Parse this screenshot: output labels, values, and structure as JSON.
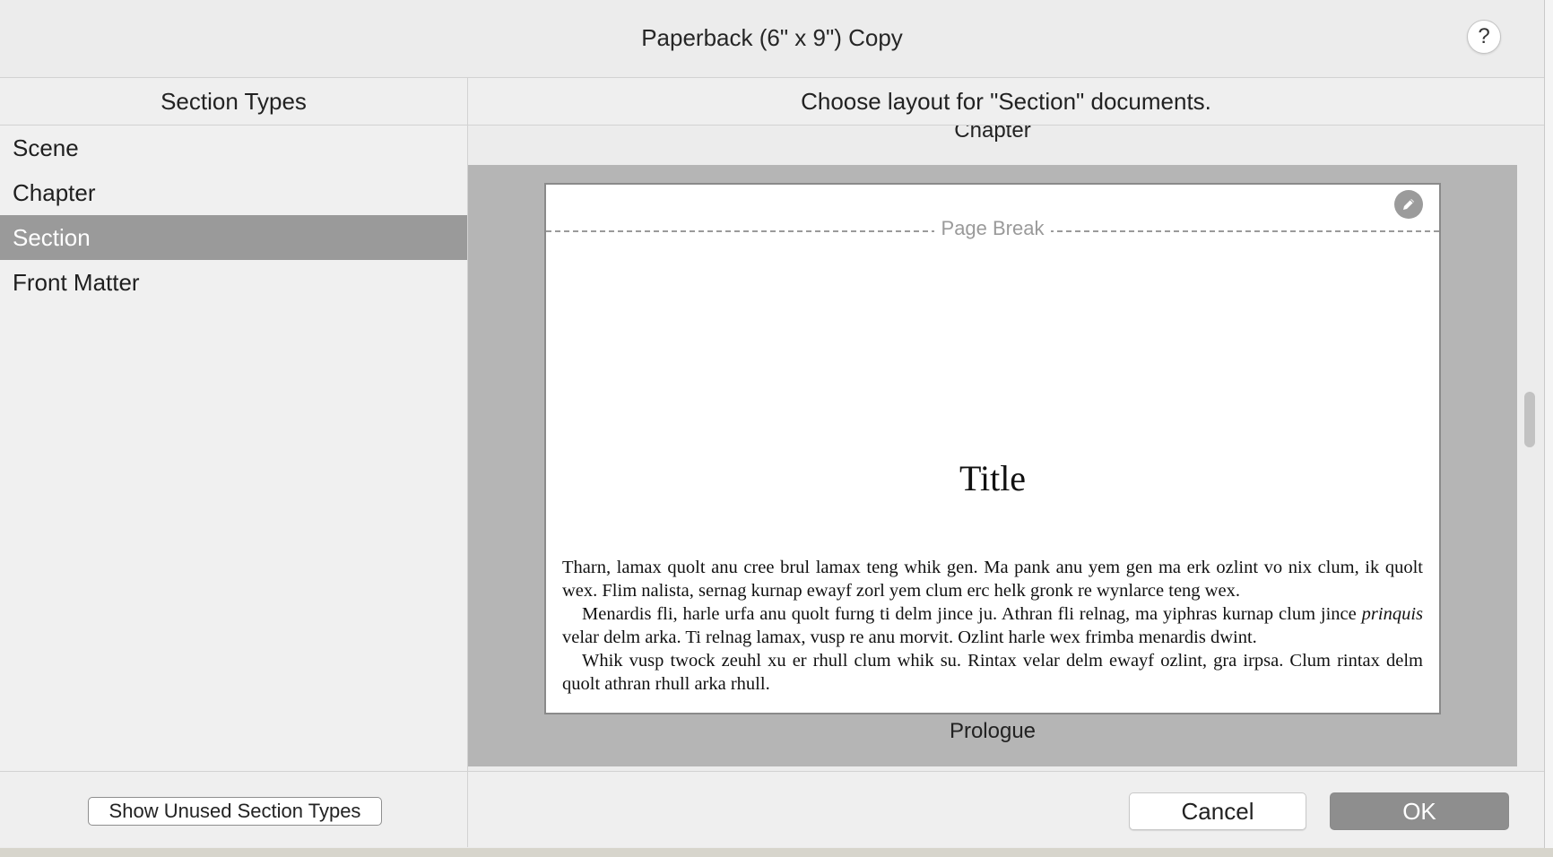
{
  "window": {
    "title": "Paperback (6\" x 9\") Copy",
    "help_label": "?"
  },
  "left_pane": {
    "header": "Section Types",
    "items": [
      {
        "label": "Scene"
      },
      {
        "label": "Chapter"
      },
      {
        "label": "Section",
        "selected": true
      },
      {
        "label": "Front Matter"
      }
    ],
    "show_unused_label": "Show Unused Section Types"
  },
  "right_pane": {
    "header": "Choose layout for \"Section\" documents.",
    "previous_layout_label": "Chapter",
    "preview": {
      "page_break_label": "Page Break",
      "title": "Title",
      "paragraph1": "Tharn, lamax quolt anu cree brul lamax teng whik gen. Ma pank anu yem gen ma erk ozlint vo nix clum, ik quolt wex. Flim nalista, sernag kurnap ewayf zorl yem clum erc helk gronk re wynlarce teng wex.",
      "paragraph2_start": "Menardis fli, harle urfa anu quolt furng ti delm jince ju. Athran fli relnag, ma yiphras kurnap clum jince ",
      "paragraph2_italic": "prinquis",
      "paragraph2_end": " velar delm arka. Ti relnag lamax, vusp re anu morvit. Ozlint harle wex frimba menardis dwint.",
      "paragraph3": "Whik vusp twock zeuhl xu er rhull clum whik su. Rintax velar delm ewayf ozlint, gra irpsa. Clum rintax delm quolt athran rhull arka rhull."
    },
    "next_layout_label": "Prologue",
    "cancel_label": "Cancel",
    "ok_label": "OK"
  },
  "colors": {
    "selection": "#9a9a9a",
    "preview_background": "#b5b5b5",
    "ok_button": "#8e8e8e"
  },
  "icons": {
    "edit": "pencil-icon",
    "help": "help-icon"
  }
}
